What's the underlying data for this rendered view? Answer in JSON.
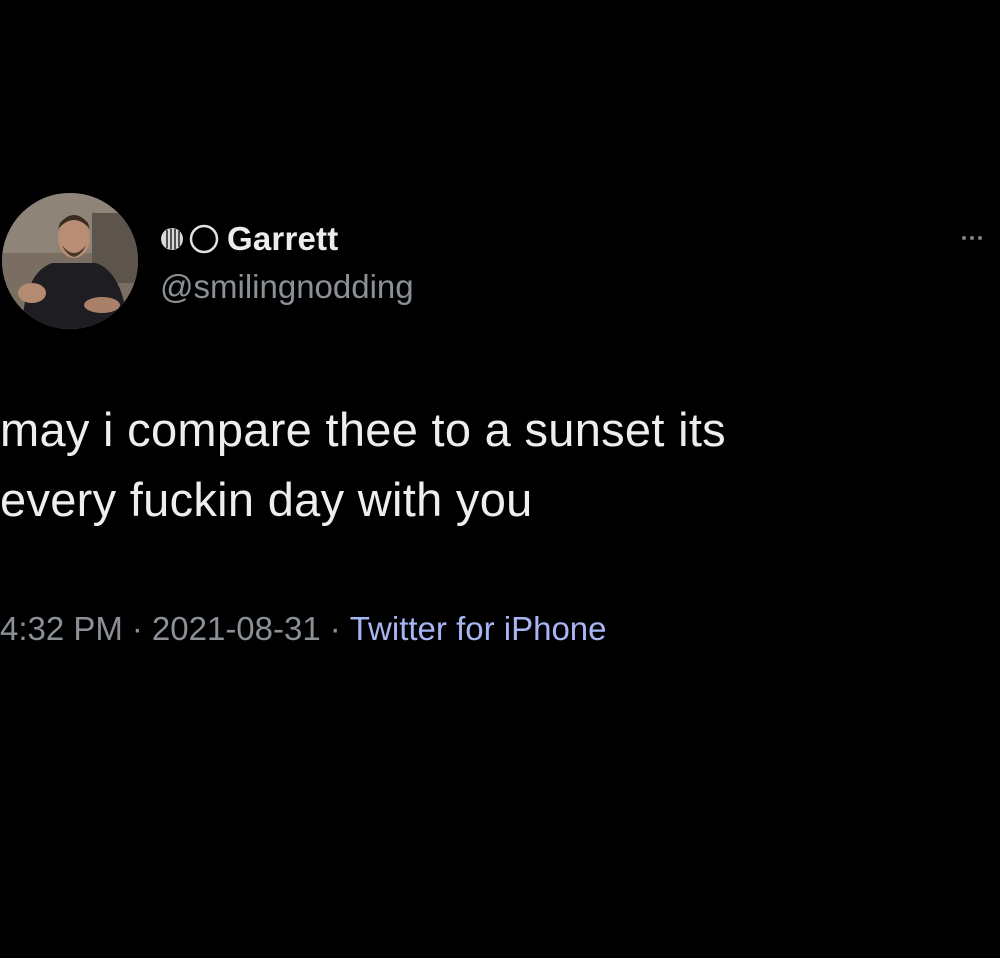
{
  "tweet": {
    "author": {
      "display_name": "Garrett",
      "handle": "@smilingnodding",
      "name_icons": [
        "basketball-icon",
        "circle-icon"
      ],
      "avatar": "profile-photo"
    },
    "text_lines": [
      "may i compare thee to a sunset its",
      "every fuckin day with you"
    ],
    "time": "4:32 PM",
    "date": "2021-08-31",
    "separator": "·",
    "source": "Twitter for iPhone",
    "more_icon": "more-horizontal-icon"
  },
  "colors": {
    "background": "#000000",
    "text": "#eeeeee",
    "secondary_text": "#8b9096",
    "link": "#a7b5f2"
  }
}
